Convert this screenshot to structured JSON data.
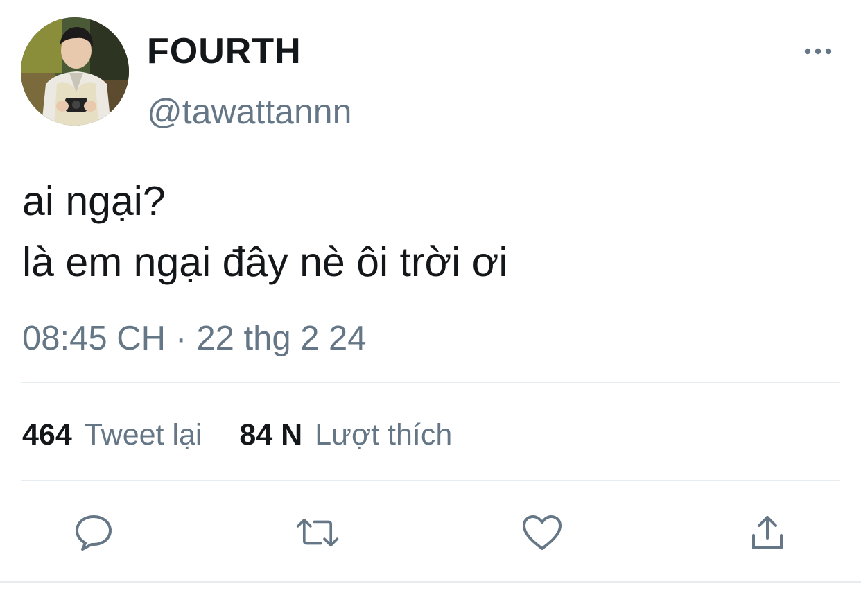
{
  "user": {
    "display_name": "FOURTH",
    "handle": "@tawattannn"
  },
  "tweet": {
    "lines": [
      "ai ngại?",
      "là em ngại đây nè ôi trời ơi"
    ],
    "time": "08:45 CH",
    "separator": "·",
    "date": "22 thg 2 24"
  },
  "stats": {
    "retweets": "464",
    "retweets_label": "Tweet lại",
    "likes": "84 N",
    "likes_label": "Lượt thích"
  },
  "icons": {
    "more": "more-icon",
    "reply": "reply-icon",
    "retweet": "retweet-icon",
    "like": "heart-icon",
    "share": "share-icon"
  },
  "colors": {
    "text": "#14171a",
    "secondary": "#657786",
    "divider": "#e6ecf0"
  }
}
